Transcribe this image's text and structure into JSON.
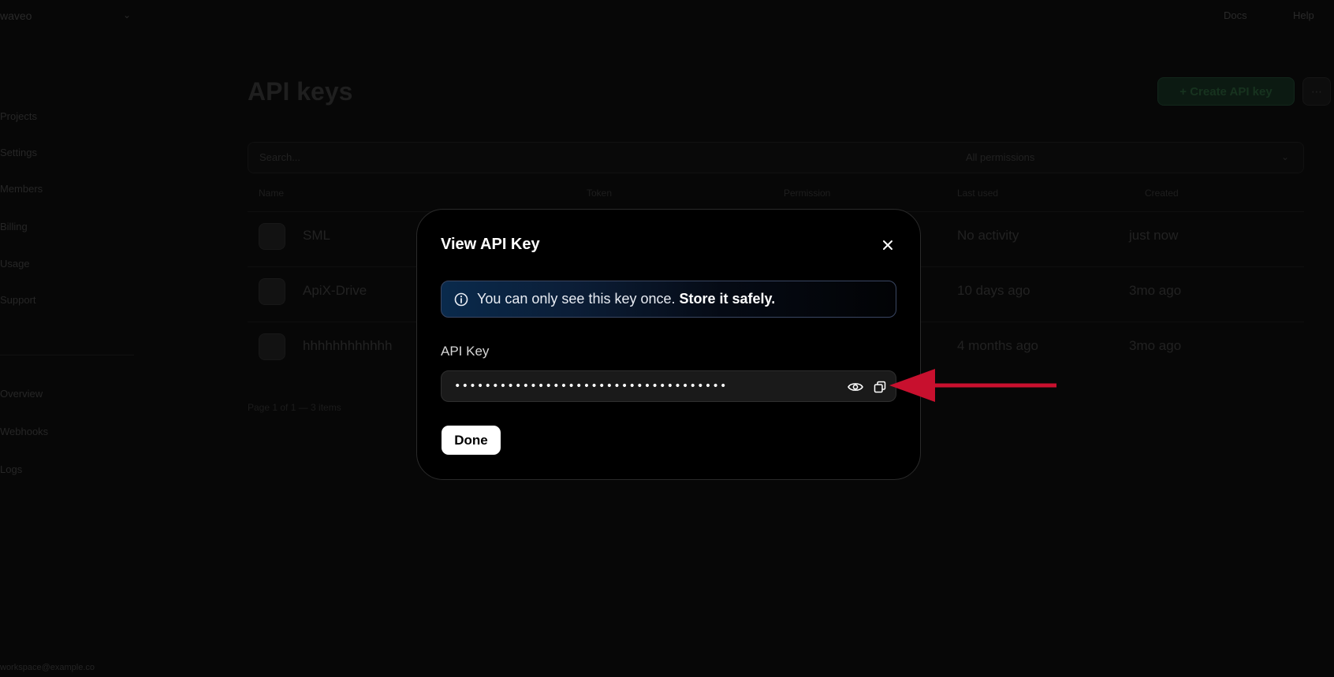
{
  "background": {
    "brand": "waveo",
    "top_links": [
      "Docs",
      "Help"
    ],
    "sidebar_items": [
      "Projects",
      "Settings",
      "Members",
      "Billing",
      "Usage",
      "Support",
      "Overview",
      "Webhooks",
      "Logs"
    ],
    "sidebar_footer": "workspace@example.co",
    "page_title": "API keys",
    "create_button": "+ Create API key",
    "filter_search_placeholder": "Search...",
    "filter_permissions": "All permissions",
    "table_headers": [
      "Name",
      "Token",
      "Permission",
      "Last used",
      "Created"
    ],
    "rows": [
      {
        "name": "SML",
        "last_used": "No activity",
        "created": "just now"
      },
      {
        "name": "ApiX-Drive",
        "last_used": "10 days ago",
        "created": "3mo ago"
      },
      {
        "name": "hhhhhhhhhhhh",
        "last_used": "4 months ago",
        "created": "3mo ago"
      }
    ],
    "table_footer": "Page 1 of 1 — 3 items"
  },
  "modal": {
    "title": "View API Key",
    "info_message": "You can only see this key once.",
    "info_message_strong": "Store it safely.",
    "field_label": "API Key",
    "masked_key": "••••••••••••••••••••••••••••••••••••",
    "done_label": "Done"
  },
  "colors": {
    "modal_bg": "#000000",
    "banner_start": "#0a2a4c",
    "annotation_arrow": "#c8102e",
    "done_bg": "#ffffff"
  },
  "icons": {
    "close": "close-icon",
    "info": "info-icon",
    "reveal": "eye-icon",
    "copy": "copy-icon",
    "annotation": "red-arrow-icon"
  }
}
